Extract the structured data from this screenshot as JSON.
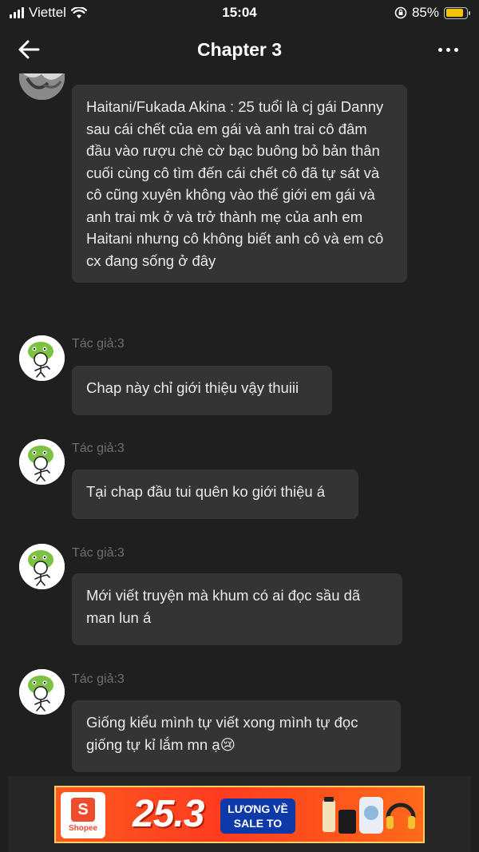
{
  "status_bar": {
    "carrier": "Viettel",
    "time": "15:04",
    "battery_percent": "85%",
    "battery_level": 0.85
  },
  "nav": {
    "title": "Chapter 3"
  },
  "messages": [
    {
      "author": "",
      "text": "Haitani/Fukada Akina : 25 tuổi là cj gái Danny sau cái chết của em gái và anh trai cô đâm đầu vào rượu chè cờ bạc buông bỏ bản thân cuối cùng cô tìm đến cái chết cô đã tự sát và cô cũng xuyên không vào thế giới em gái và anh trai mk ở và trở thành mẹ của anh em Haitani nhưng cô không biết anh cô và em cô cx đang sống ở đây"
    },
    {
      "author": "Tác giả:3",
      "text": "Chap này chỉ giới thiệu vậy thuiii"
    },
    {
      "author": "Tác giả:3",
      "text": "Tại chap đầu tui quên ko giới thiệu á"
    },
    {
      "author": "Tác giả:3",
      "text": "Mới viết truyện mà khum có ai đọc sầu dã man lun á"
    },
    {
      "author": "Tác giả:3",
      "text": "Giống kiểu mình tự viết xong mình tự đọc giống tự kỉ lắm mn ạ😢"
    }
  ],
  "ad": {
    "brand": "Shopee",
    "logo_letter": "S",
    "date": "25.3",
    "tag_line1": "LƯƠNG VỀ",
    "tag_line2": "SALE TO"
  },
  "colors": {
    "background": "#1f1f1f",
    "bubble": "#343434",
    "author_text": "#6f6f6f",
    "battery": "#f5c400",
    "shopee": "#ee4d2d"
  }
}
